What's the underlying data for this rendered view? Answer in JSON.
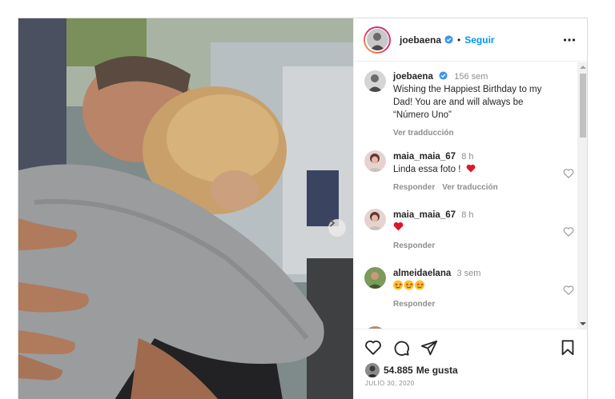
{
  "post": {
    "author": "joebaena",
    "follow_label": "Seguir",
    "separator": "•",
    "caption": {
      "user": "joebaena",
      "time": "156 sem",
      "text": "Wishing the Happiest Birthday to my Dad! You are and will always be “Número Uno”",
      "translate": "Ver tradducción"
    },
    "likes": "54.885",
    "likes_label": "Me gusta",
    "date": "JULIO 30, 2020"
  },
  "comments": [
    {
      "user": "maia_maia_67",
      "time": "8 h",
      "text": "Linda essa foto !",
      "emoji": "heart",
      "reply": "Responder",
      "translate": "Ver traducción"
    },
    {
      "user": "maia_maia_67",
      "time": "8 h",
      "text": "",
      "emoji": "heart",
      "reply": "Responder"
    },
    {
      "user": "almeidaelana",
      "time": "3 sem",
      "text": "",
      "emoji": "star-eyes x3",
      "reply": "Responder"
    }
  ],
  "icons": [
    "verified-badge-icon",
    "more-options-icon",
    "heart-icon",
    "comment-icon",
    "share-icon",
    "bookmark-icon",
    "next-arrow-icon"
  ],
  "colors": {
    "link_blue": "#0095f6",
    "like_red": "#ed4956",
    "text": "#262626",
    "muted": "#8e8e8e"
  }
}
